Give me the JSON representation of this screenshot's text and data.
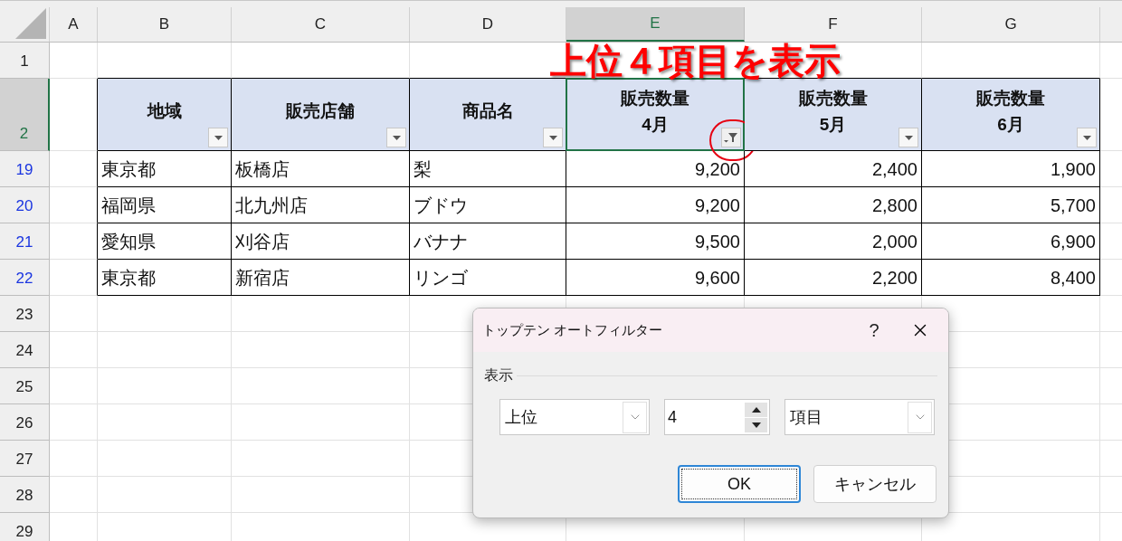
{
  "column_headers": [
    {
      "label": "A",
      "selected": false
    },
    {
      "label": "B",
      "selected": false
    },
    {
      "label": "C",
      "selected": false
    },
    {
      "label": "D",
      "selected": false
    },
    {
      "label": "E",
      "selected": true
    },
    {
      "label": "F",
      "selected": false
    },
    {
      "label": "G",
      "selected": false
    }
  ],
  "rows": [
    {
      "number": "1",
      "filtered": false,
      "selected": false,
      "cells": []
    },
    {
      "number": "2",
      "filtered": false,
      "selected": true,
      "cells": [
        {
          "kind": "header",
          "lines": [
            "地域"
          ],
          "filter_active": false,
          "selected": false
        },
        {
          "kind": "header",
          "lines": [
            "販売店舗"
          ],
          "filter_active": false,
          "selected": false
        },
        {
          "kind": "header",
          "lines": [
            "商品名"
          ],
          "filter_active": false,
          "selected": false
        },
        {
          "kind": "header",
          "lines": [
            "販売数量",
            "4月"
          ],
          "filter_active": true,
          "selected": true
        },
        {
          "kind": "header",
          "lines": [
            "販売数量",
            "5月"
          ],
          "filter_active": false,
          "selected": false
        },
        {
          "kind": "header",
          "lines": [
            "販売数量",
            "6月"
          ],
          "filter_active": false,
          "selected": false
        }
      ]
    },
    {
      "number": "19",
      "filtered": true,
      "selected": false,
      "cells": [
        {
          "kind": "text",
          "text": "東京都"
        },
        {
          "kind": "text",
          "text": "板橋店"
        },
        {
          "kind": "text",
          "text": "梨"
        },
        {
          "kind": "number",
          "text": "9,200"
        },
        {
          "kind": "number",
          "text": "2,400"
        },
        {
          "kind": "number",
          "text": "1,900"
        }
      ]
    },
    {
      "number": "20",
      "filtered": true,
      "selected": false,
      "cells": [
        {
          "kind": "text",
          "text": "福岡県"
        },
        {
          "kind": "text",
          "text": "北九州店"
        },
        {
          "kind": "text",
          "text": "ブドウ"
        },
        {
          "kind": "number",
          "text": "9,200"
        },
        {
          "kind": "number",
          "text": "2,800"
        },
        {
          "kind": "number",
          "text": "5,700"
        }
      ]
    },
    {
      "number": "21",
      "filtered": true,
      "selected": false,
      "cells": [
        {
          "kind": "text",
          "text": "愛知県"
        },
        {
          "kind": "text",
          "text": "刈谷店"
        },
        {
          "kind": "text",
          "text": "バナナ"
        },
        {
          "kind": "number",
          "text": "9,500"
        },
        {
          "kind": "number",
          "text": "2,000"
        },
        {
          "kind": "number",
          "text": "6,900"
        }
      ]
    },
    {
      "number": "22",
      "filtered": true,
      "selected": false,
      "cells": [
        {
          "kind": "text",
          "text": "東京都"
        },
        {
          "kind": "text",
          "text": "新宿店"
        },
        {
          "kind": "text",
          "text": "リンゴ"
        },
        {
          "kind": "number",
          "text": "9,600"
        },
        {
          "kind": "number",
          "text": "2,200"
        },
        {
          "kind": "number",
          "text": "8,400"
        }
      ]
    },
    {
      "number": "23",
      "filtered": false,
      "selected": false,
      "cells": []
    },
    {
      "number": "24",
      "filtered": false,
      "selected": false,
      "cells": []
    },
    {
      "number": "25",
      "filtered": false,
      "selected": false,
      "cells": []
    },
    {
      "number": "26",
      "filtered": false,
      "selected": false,
      "cells": []
    },
    {
      "number": "27",
      "filtered": false,
      "selected": false,
      "cells": []
    },
    {
      "number": "28",
      "filtered": false,
      "selected": false,
      "cells": []
    },
    {
      "number": "29",
      "filtered": false,
      "selected": false,
      "cells": []
    }
  ],
  "banner": {
    "text": "上位４項目を表示"
  },
  "dialog": {
    "title": "トップテン オートフィルター",
    "help": "?",
    "group_label": "表示",
    "order": {
      "value": "上位"
    },
    "count": {
      "value": "4"
    },
    "unit": {
      "value": "項目"
    },
    "buttons": [
      {
        "label": "OK",
        "default": true
      },
      {
        "label": "キャンセル",
        "default": false
      }
    ]
  }
}
